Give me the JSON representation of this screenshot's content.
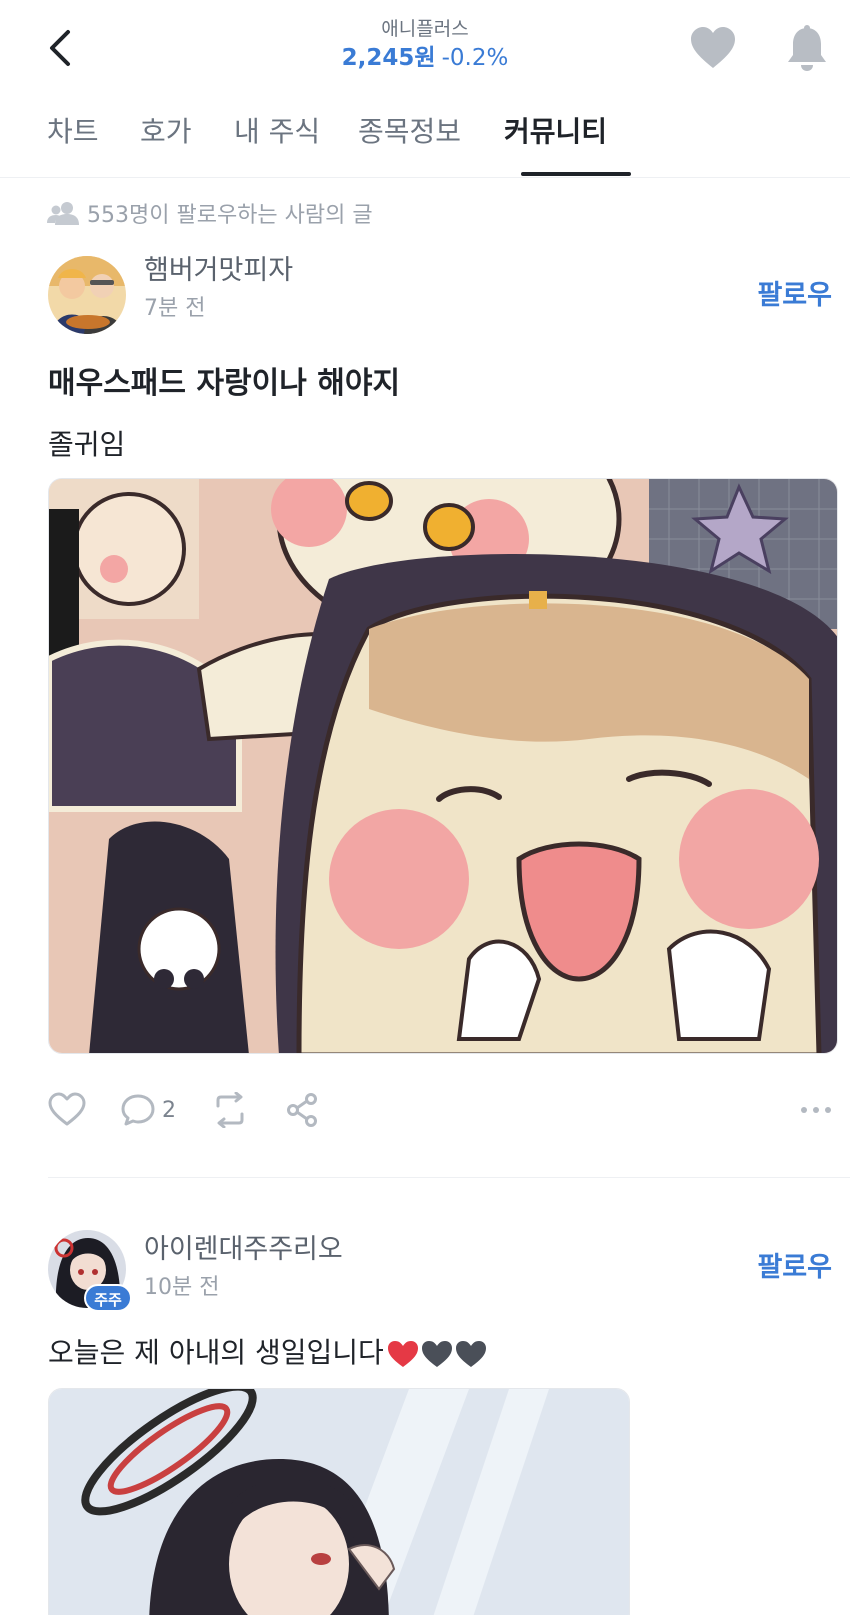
{
  "header": {
    "stock_name": "애니플러스",
    "price": "2,245원",
    "change": "-0.2%"
  },
  "tabs": [
    {
      "label": "차트"
    },
    {
      "label": "호가"
    },
    {
      "label": "내 주식"
    },
    {
      "label": "종목정보"
    },
    {
      "label": "커뮤니티",
      "active": true
    }
  ],
  "followers_note": "553명이 팔로우하는 사람의 글",
  "posts": [
    {
      "author": "햄버거맛피자",
      "time": "7분 전",
      "follow_label": "팔로우",
      "title": "매우스패드 자랑이나 해야지",
      "body": "졸귀임",
      "comment_count": "2"
    },
    {
      "author": "아이렌대주주리오",
      "badge": "주주",
      "time": "10분 전",
      "follow_label": "팔로우",
      "body": "오늘은 제 아내의 생일입니다"
    }
  ],
  "colors": {
    "accent": "#3a7bd5",
    "heart_red": "#e53945",
    "heart_dark": "#4a4f58"
  }
}
